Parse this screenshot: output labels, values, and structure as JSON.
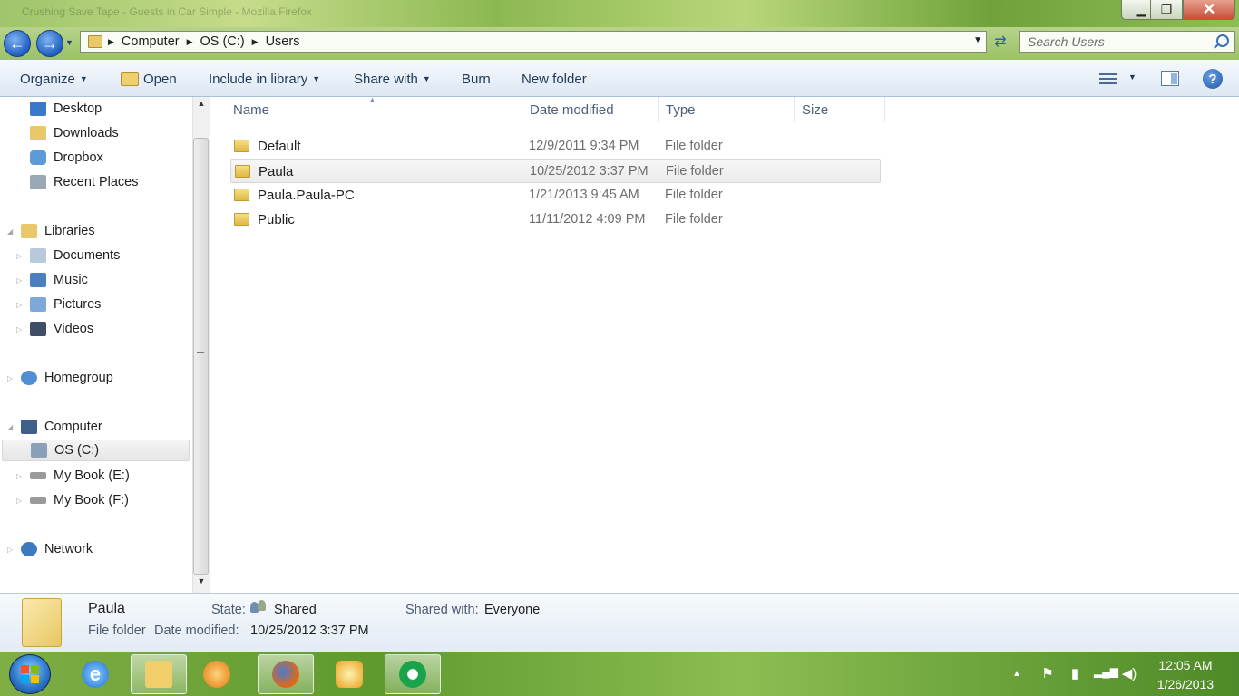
{
  "window": {
    "title_ghost": "Crushing Save Tape - Guests in Car Simple - Mozilla Firefox"
  },
  "caption": {
    "minimize": "▁",
    "maximize": "❐",
    "close": "✕"
  },
  "address": {
    "crumbs": [
      "Computer",
      "OS (C:)",
      "Users"
    ]
  },
  "search": {
    "placeholder": "Search Users"
  },
  "toolbar": {
    "organize": "Organize",
    "open": "Open",
    "include": "Include in library",
    "share": "Share with",
    "burn": "Burn",
    "new_folder": "New folder"
  },
  "nav": {
    "favorites": [
      "Desktop",
      "Downloads",
      "Dropbox",
      "Recent Places"
    ],
    "libraries": "Libraries",
    "library_items": [
      "Documents",
      "Music",
      "Pictures",
      "Videos"
    ],
    "homegroup": "Homegroup",
    "computer": "Computer",
    "drives": [
      "OS (C:)",
      "My Book (E:)",
      "My Book (F:)"
    ],
    "network": "Network"
  },
  "columns": {
    "name": "Name",
    "date": "Date modified",
    "type": "Type",
    "size": "Size"
  },
  "files": [
    {
      "name": "Default",
      "date": "12/9/2011 9:34 PM",
      "type": "File folder"
    },
    {
      "name": "Paula",
      "date": "10/25/2012 3:37 PM",
      "type": "File folder"
    },
    {
      "name": "Paula.Paula-PC",
      "date": "1/21/2013 9:45 AM",
      "type": "File folder"
    },
    {
      "name": "Public",
      "date": "11/11/2012 4:09 PM",
      "type": "File folder"
    }
  ],
  "details": {
    "name": "Paula",
    "kind": "File folder",
    "state_label": "State:",
    "state_value": "Shared",
    "shared_label": "Shared with:",
    "shared_value": "Everyone",
    "date_label": "Date modified:",
    "date_value": "10/25/2012 3:37 PM"
  },
  "taskbar": {
    "time": "12:05 AM",
    "date": "1/26/2013"
  },
  "colors": {
    "taskbar": "#5f9a2e",
    "toolbar_text": "#1e395b",
    "selection": "#e6e6e6"
  }
}
